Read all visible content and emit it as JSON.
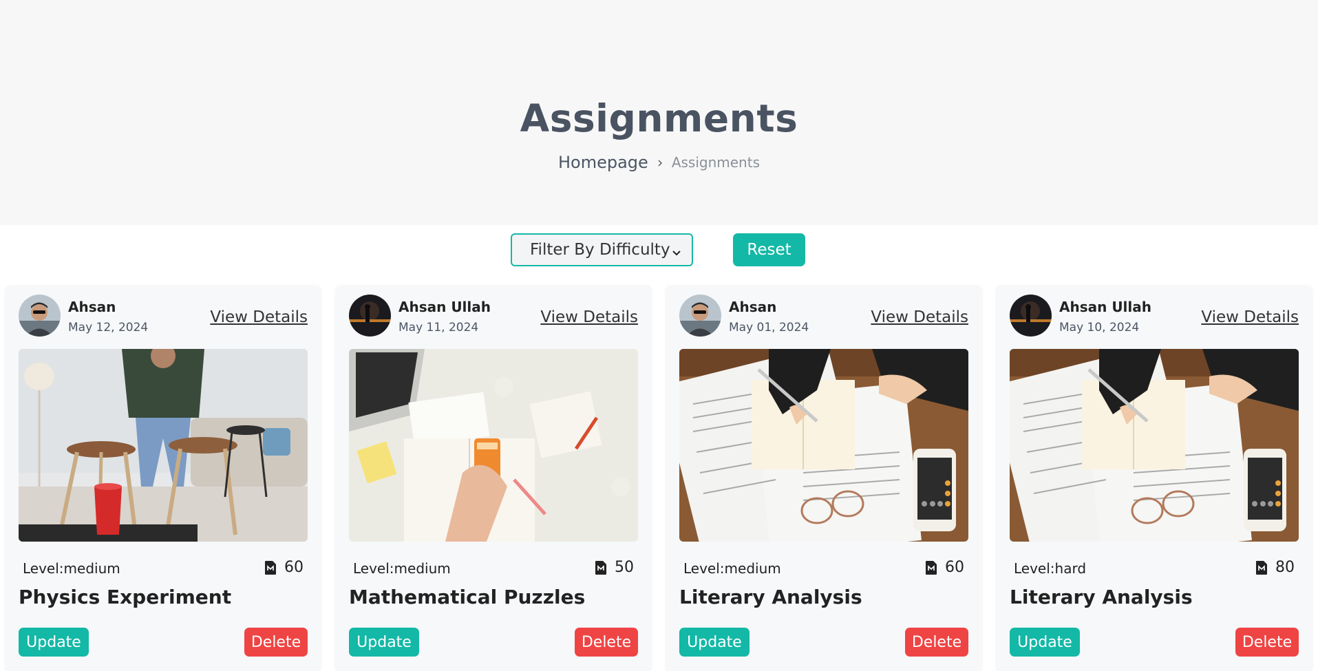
{
  "header": {
    "title": "Assignments",
    "breadcrumb": {
      "home": "Homepage",
      "current": "Assignments"
    }
  },
  "filters": {
    "difficulty_select": "Filter By Difficulty",
    "reset_label": "Reset"
  },
  "cards": [
    {
      "author": "Ahsan",
      "date": "May 12, 2024",
      "view_label": "View Details",
      "level_prefix": "Level:",
      "level": "medium",
      "marks": "60",
      "title": "Physics Experiment",
      "update_label": "Update",
      "delete_label": "Delete"
    },
    {
      "author": "Ahsan Ullah",
      "date": "May 11, 2024",
      "view_label": "View Details",
      "level_prefix": "Level:",
      "level": "medium",
      "marks": "50",
      "title": "Mathematical Puzzles",
      "update_label": "Update",
      "delete_label": "Delete"
    },
    {
      "author": "Ahsan",
      "date": "May 01, 2024",
      "view_label": "View Details",
      "level_prefix": "Level:",
      "level": "medium",
      "marks": "60",
      "title": "Literary Analysis",
      "update_label": "Update",
      "delete_label": "Delete"
    },
    {
      "author": "Ahsan Ullah",
      "date": "May 10, 2024",
      "view_label": "View Details",
      "level_prefix": "Level:",
      "level": "hard",
      "marks": "80",
      "title": "Literary Analysis",
      "update_label": "Update",
      "delete_label": "Delete"
    }
  ],
  "colors": {
    "accent": "#14b8a6",
    "danger": "#ef4444",
    "hero_bg": "#f7f7f7",
    "card_bg": "#f6f8fa"
  },
  "icons": {
    "marks": "document-icon",
    "breadcrumb_sep": "chevron-right-icon",
    "select": "chevron-down-icon"
  }
}
